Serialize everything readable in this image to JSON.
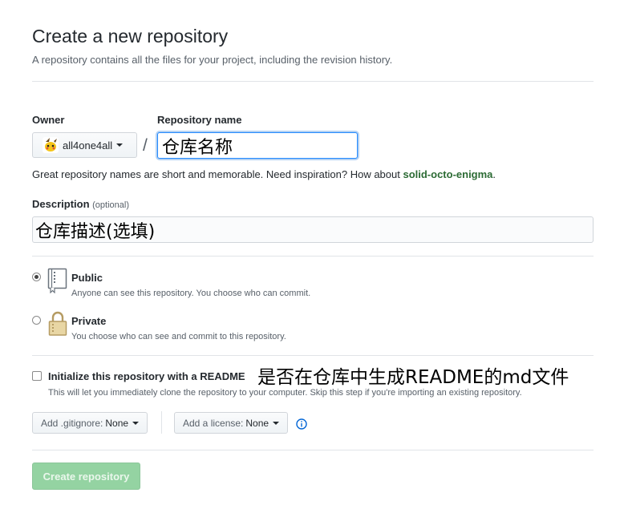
{
  "header": {
    "title": "Create a new repository",
    "subtitle": "A repository contains all the files for your project, including the revision history."
  },
  "owner": {
    "label": "Owner",
    "value": "all4one4all"
  },
  "separator": "/",
  "repo_name": {
    "label": "Repository name",
    "value": "仓库名称"
  },
  "hint": {
    "text": "Great repository names are short and memorable. Need inspiration? How about ",
    "suggestion": "solid-octo-enigma",
    "end": "."
  },
  "description": {
    "label": "Description",
    "optional": "(optional)",
    "value": "仓库描述(选填)"
  },
  "visibility": {
    "public": {
      "title": "Public",
      "desc": "Anyone can see this repository. You choose who can commit.",
      "selected": true
    },
    "private": {
      "title": "Private",
      "desc": "You choose who can see and commit to this repository.",
      "selected": false
    }
  },
  "init": {
    "label": "Initialize this repository with a README",
    "desc": "This will let you immediately clone the repository to your computer. Skip this step if you're importing an existing repository.",
    "checked": false
  },
  "annotation": "是否在仓库中生成README的md文件",
  "gitignore": {
    "label": "Add .gitignore:",
    "value": "None"
  },
  "license": {
    "label": "Add a license:",
    "value": "None"
  },
  "submit_label": "Create repository"
}
